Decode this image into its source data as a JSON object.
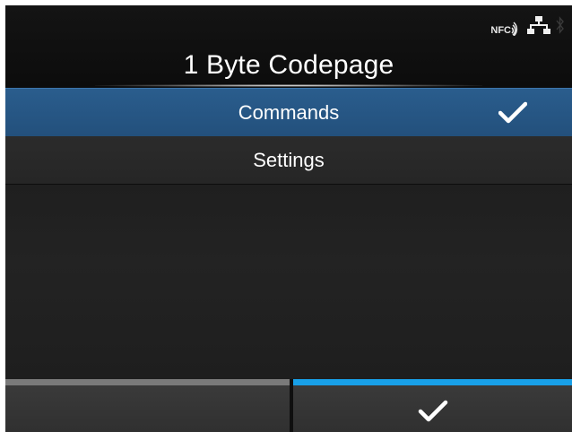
{
  "header": {
    "title": "1 Byte Codepage",
    "status_icons": [
      "nfc-icon",
      "network-icon",
      "bluetooth-icon"
    ],
    "nfc_label": "NFC"
  },
  "list": {
    "items": [
      {
        "label": "Commands",
        "selected": true,
        "checked": true
      },
      {
        "label": "Settings",
        "selected": false,
        "checked": false
      }
    ]
  },
  "footer": {
    "left_button": {
      "label": "",
      "accent": "#7a7a7a"
    },
    "right_button": {
      "icon": "check-icon",
      "accent": "#18a0e8"
    }
  },
  "colors": {
    "selected_row": "#2a5d8d",
    "accent_blue": "#18a0e8",
    "background": "#121212"
  }
}
